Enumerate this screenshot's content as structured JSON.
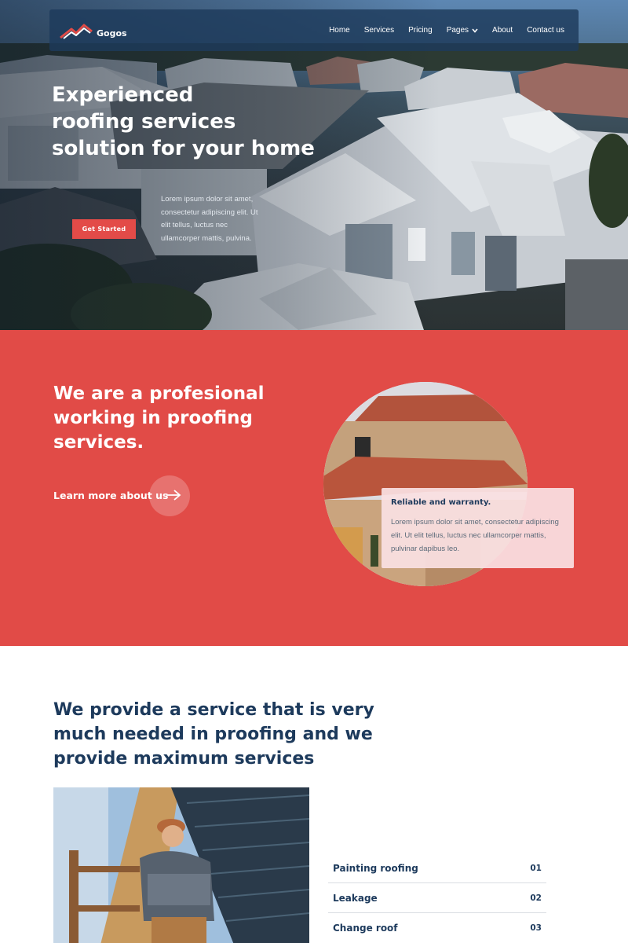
{
  "colors": {
    "accent_red": "#e14b47",
    "navy": "#1d3a5c",
    "nav_bg": "#1d3a5c"
  },
  "nav": {
    "logo_text": "Gogos",
    "logo_icon": "roof-house-icon",
    "links": [
      {
        "label": "Home"
      },
      {
        "label": "Services"
      },
      {
        "label": "Pricing"
      },
      {
        "label": "Pages",
        "icon": "chevron-down-icon"
      },
      {
        "label": "About"
      },
      {
        "label": "Contact us"
      }
    ]
  },
  "hero": {
    "title_lines": [
      "Experienced",
      "roofing services",
      "solution for your home"
    ],
    "description": "Lorem ipsum dolor sit amet, consectetur adipiscing elit. Ut elit tellus, luctus nec ullamcorper mattis, pulvina.",
    "cta_label": "Get Started"
  },
  "about": {
    "title": "We are a profesional working in proofing services.",
    "learn_more_label": "Learn more about us",
    "learn_more_icon": "arrow-right-icon",
    "card": {
      "title": "Reliable and warranty.",
      "description": "Lorem ipsum dolor sit amet, consectetur adipiscing elit. Ut elit tellus, luctus nec ullamcorper mattis, pulvinar dapibus leo."
    }
  },
  "services": {
    "title": "We provide a service that is very much needed in proofing and we provide maximum services",
    "items": [
      {
        "name": "Painting roofing",
        "number": "01"
      },
      {
        "name": "Leakage",
        "number": "02"
      },
      {
        "name": "Change roof",
        "number": "03"
      }
    ]
  }
}
